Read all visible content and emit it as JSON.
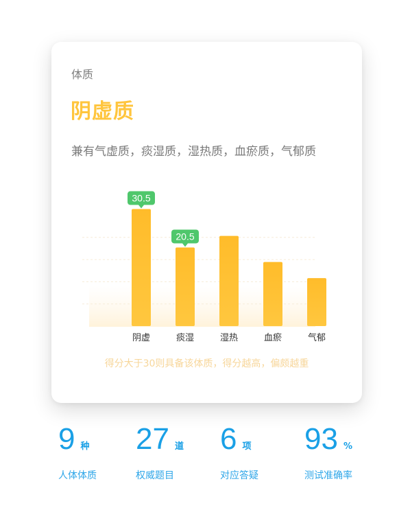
{
  "card": {
    "label": "体质",
    "type": "阴虚质",
    "also": "兼有气虚质，痰湿质，湿热质，血瘀质，气郁质",
    "note": "得分大于30则具备该体质，得分越高，偏颇越重"
  },
  "chart_data": {
    "type": "bar",
    "categories": [
      "阴虚",
      "痰湿",
      "湿热",
      "血瘀",
      "气郁"
    ],
    "values": [
      30.5,
      20.5,
      23.5,
      16.7,
      12.5
    ],
    "data_labels": [
      "30.5",
      "20.5",
      "",
      "",
      ""
    ],
    "title": "",
    "xlabel": "",
    "ylabel": "",
    "ylim": [
      0,
      34
    ],
    "grid": true,
    "bar_color": "#ffc030",
    "tooltip_color": "#4fc76c"
  },
  "stats": [
    {
      "number": "9",
      "unit": "种",
      "caption": "人体体质"
    },
    {
      "number": "27",
      "unit": "道",
      "caption": "权威题目"
    },
    {
      "number": "6",
      "unit": "项",
      "caption": "对应答疑"
    },
    {
      "number": "93",
      "unit": "%",
      "caption": "测试准确率"
    }
  ],
  "colors": {
    "accent_orange": "#ffc53d",
    "stat_blue": "#1aa0e6"
  }
}
